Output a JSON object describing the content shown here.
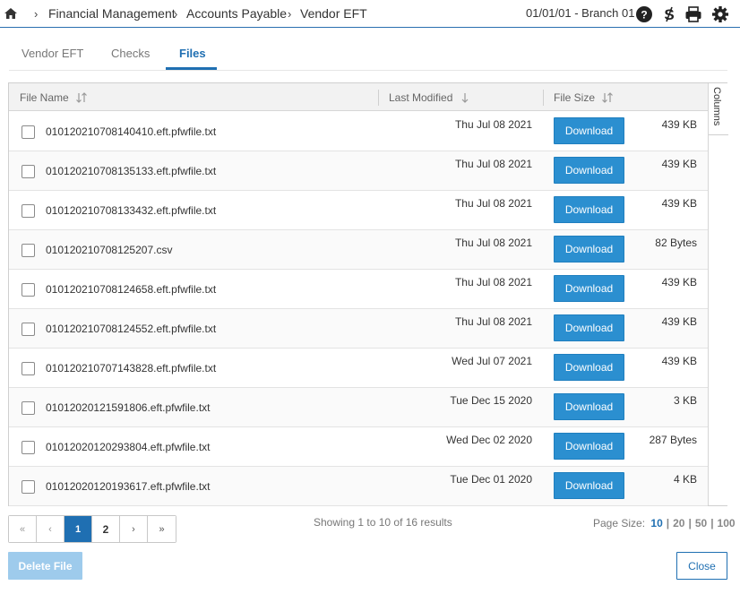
{
  "breadcrumb": {
    "items": [
      "Financial Management",
      "Accounts Payable",
      "Vendor EFT"
    ]
  },
  "header": {
    "branch": "01/01/01 - Branch 01"
  },
  "tabs": [
    {
      "label": "Vendor EFT",
      "active": false
    },
    {
      "label": "Checks",
      "active": false
    },
    {
      "label": "Files",
      "active": true
    }
  ],
  "grid": {
    "columns": {
      "file_name": "File Name",
      "last_modified": "Last Modified",
      "file_size": "File Size"
    },
    "side_panel_label": "Columns",
    "download_label": "Download",
    "rows": [
      {
        "name": "010120210708140410.eft.pfwfile.txt",
        "date": "Thu Jul 08 2021",
        "size": "439 KB"
      },
      {
        "name": "010120210708135133.eft.pfwfile.txt",
        "date": "Thu Jul 08 2021",
        "size": "439 KB"
      },
      {
        "name": "010120210708133432.eft.pfwfile.txt",
        "date": "Thu Jul 08 2021",
        "size": "439 KB"
      },
      {
        "name": "010120210708125207.csv",
        "date": "Thu Jul 08 2021",
        "size": "82 Bytes"
      },
      {
        "name": "010120210708124658.eft.pfwfile.txt",
        "date": "Thu Jul 08 2021",
        "size": "439 KB"
      },
      {
        "name": "010120210708124552.eft.pfwfile.txt",
        "date": "Thu Jul 08 2021",
        "size": "439 KB"
      },
      {
        "name": "010120210707143828.eft.pfwfile.txt",
        "date": "Wed Jul 07 2021",
        "size": "439 KB"
      },
      {
        "name": "01012020121591806.eft.pfwfile.txt",
        "date": "Tue Dec 15 2020",
        "size": "3 KB"
      },
      {
        "name": "01012020120293804.eft.pfwfile.txt",
        "date": "Wed Dec 02 2020",
        "size": "287 Bytes"
      },
      {
        "name": "01012020120193617.eft.pfwfile.txt",
        "date": "Tue Dec 01 2020",
        "size": "4 KB"
      }
    ]
  },
  "pagination": {
    "first": "«",
    "prev": "‹",
    "pages": [
      "1",
      "2"
    ],
    "current_page": 1,
    "next": "›",
    "last": "»",
    "showing": "Showing 1 to 10 of 16 results",
    "page_size_label": "Page Size:",
    "page_size_options": [
      "10",
      "20",
      "50",
      "100"
    ],
    "page_size_selected": "10"
  },
  "footer": {
    "delete_label": "Delete File",
    "close_label": "Close"
  },
  "colors": {
    "accent": "#1f6fb2",
    "download_button": "#2b8fd0",
    "delete_disabled": "#9ecbec"
  }
}
